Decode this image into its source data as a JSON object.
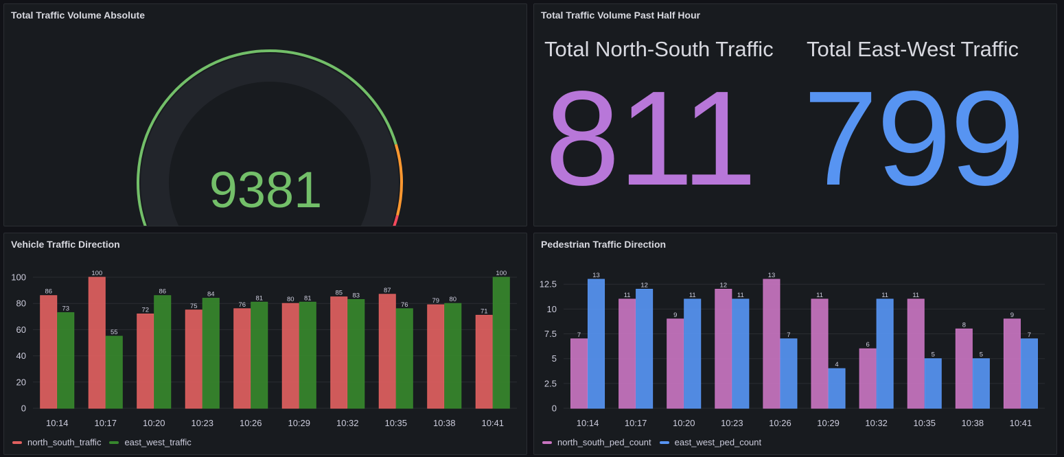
{
  "panels": {
    "gauge": {
      "title": "Total Traffic Volume Absolute",
      "value": "9381",
      "value_num": 9381,
      "value_color": "#73bf69",
      "thresholds": [
        {
          "color": "#73bf69",
          "from": 0,
          "to": 0.82
        },
        {
          "color": "#ff9830",
          "from": 0.82,
          "to": 0.94
        },
        {
          "color": "#f2495c",
          "from": 0.94,
          "to": 1.0
        }
      ]
    },
    "stat": {
      "title": "Total Traffic Volume Past Half Hour",
      "north_south": {
        "label": "Total North-South Traffic",
        "value": "811",
        "color": "#b877d9"
      },
      "east_west": {
        "label": "Total East-West Traffic",
        "value": "799",
        "color": "#5794f2"
      }
    },
    "vehicle": {
      "title": "Vehicle Traffic Direction",
      "legend": [
        {
          "name": "north_south_traffic",
          "color": "#e0605f"
        },
        {
          "name": "east_west_traffic",
          "color": "#37872d"
        }
      ]
    },
    "pedestrian": {
      "title": "Pedestrian Traffic Direction",
      "legend": [
        {
          "name": "north_south_ped_count",
          "color": "#c874c0"
        },
        {
          "name": "east_west_ped_count",
          "color": "#5794f2"
        }
      ]
    }
  },
  "chart_data": [
    {
      "type": "bar",
      "title": "Vehicle Traffic Direction",
      "categories": [
        "10:14",
        "10:17",
        "10:20",
        "10:23",
        "10:26",
        "10:29",
        "10:32",
        "10:35",
        "10:38",
        "10:41"
      ],
      "series": [
        {
          "name": "north_south_traffic",
          "color": "#e0605f",
          "values": [
            86,
            100,
            72,
            75,
            76,
            80,
            85,
            87,
            79,
            71
          ]
        },
        {
          "name": "east_west_traffic",
          "color": "#37872d",
          "values": [
            73,
            55,
            86,
            84,
            81,
            81,
            83,
            76,
            80,
            100
          ]
        }
      ],
      "yticks": [
        "0",
        "20",
        "40",
        "60",
        "80",
        "100"
      ],
      "ytick_values": [
        0,
        20,
        40,
        60,
        80,
        100
      ],
      "ylim": [
        0,
        100
      ],
      "grid": true,
      "legend_position": "bottom-left"
    },
    {
      "type": "bar",
      "title": "Pedestrian Traffic Direction",
      "categories": [
        "10:14",
        "10:17",
        "10:20",
        "10:23",
        "10:26",
        "10:29",
        "10:32",
        "10:35",
        "10:38",
        "10:41"
      ],
      "series": [
        {
          "name": "north_south_ped_count",
          "color": "#c874c0",
          "values": [
            7,
            11,
            9,
            12,
            13,
            11,
            6,
            11,
            8,
            9
          ]
        },
        {
          "name": "east_west_ped_count",
          "color": "#5794f2",
          "values": [
            13,
            12,
            11,
            11,
            7,
            4,
            11,
            5,
            5,
            7
          ]
        }
      ],
      "yticks": [
        "0",
        "2.5",
        "5",
        "7.5",
        "10",
        "12.5"
      ],
      "ytick_values": [
        0,
        2.5,
        5,
        7.5,
        10,
        12.5
      ],
      "ylim": [
        0,
        13
      ],
      "grid": true,
      "legend_position": "bottom-left"
    }
  ]
}
